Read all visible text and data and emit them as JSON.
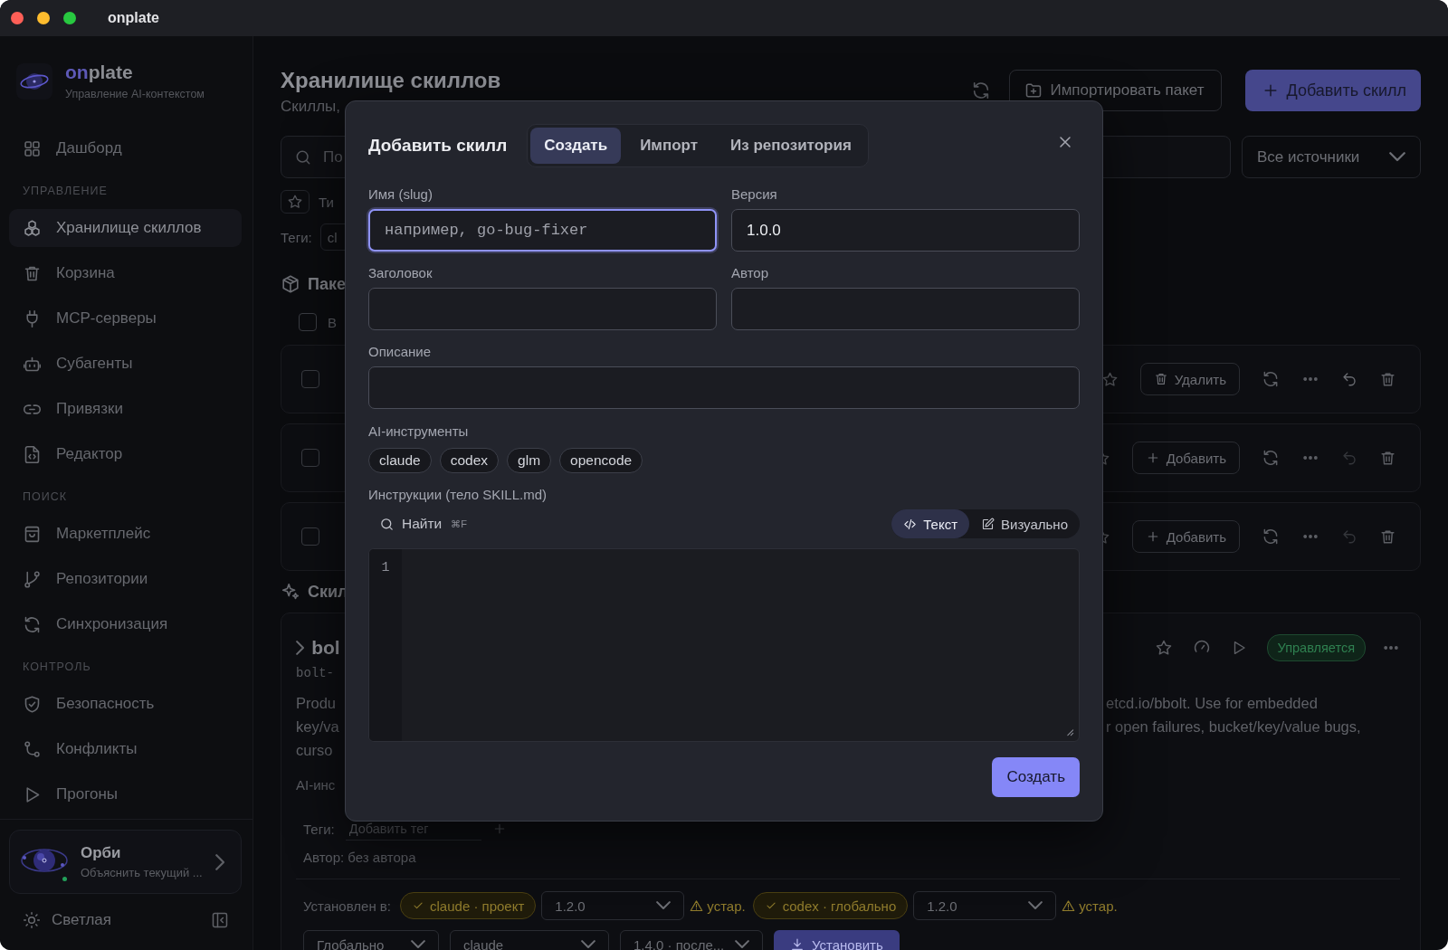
{
  "window": {
    "title": "onplate"
  },
  "sidebar": {
    "brand": {
      "accent": "on",
      "rest": "plate",
      "tagline": "Управление AI-контекстом"
    },
    "sections": [
      {
        "items": [
          {
            "label": "Дашборд",
            "selected": false
          }
        ]
      },
      {
        "heading": "УПРАВЛЕНИЕ",
        "items": [
          {
            "label": "Хранилище скиллов",
            "selected": true
          },
          {
            "label": "Корзина",
            "selected": false
          },
          {
            "label": "MCP-серверы",
            "selected": false
          },
          {
            "label": "Субагенты",
            "selected": false
          },
          {
            "label": "Привязки",
            "selected": false
          },
          {
            "label": "Редактор",
            "selected": false
          }
        ]
      },
      {
        "heading": "ПОИСК",
        "items": [
          {
            "label": "Маркетплейс",
            "selected": false
          },
          {
            "label": "Репозитории",
            "selected": false
          },
          {
            "label": "Синхронизация",
            "selected": false
          }
        ]
      },
      {
        "heading": "КОНТРОЛЬ",
        "items": [
          {
            "label": "Безопасность",
            "selected": false
          },
          {
            "label": "Конфликты",
            "selected": false
          },
          {
            "label": "Прогоны",
            "selected": false
          }
        ]
      }
    ],
    "assistant": {
      "name": "Орби",
      "hint": "Объяснить текущий ...",
      "online": true
    },
    "theme_toggle": "Светлая"
  },
  "page": {
    "title": "Хранилище скиллов",
    "subtitle": "Скиллы,",
    "import_button": "Импортировать пакет",
    "add_button": "Добавить скилл",
    "search_placeholder": "По",
    "source_filter": "Все источники",
    "type_label": "Ти",
    "tags_label": "Теги:",
    "tags": [
      "cl"
    ]
  },
  "packages": {
    "heading": "Паке",
    "select_all": {
      "label": "В",
      "checked": false
    },
    "rows": [
      {
        "checked": false,
        "kind": "remove",
        "action": "Удалить",
        "undo_enabled": true
      },
      {
        "checked": false,
        "kind": "add",
        "action": "Добавить",
        "undo_enabled": false
      },
      {
        "checked": false,
        "kind": "add",
        "action": "Добавить",
        "undo_enabled": false
      }
    ]
  },
  "skills": {
    "heading": "Скил",
    "card": {
      "expanded": false,
      "name": "bol",
      "slug": "bolt-",
      "description_start": [
        "Produ",
        "key/va",
        "curso"
      ],
      "description_end": [
        "etcd.io/bbolt. Use for embedded",
        "r open failures, bucket/key/value bugs,"
      ],
      "status": "Управляется",
      "tools_label": "AI-инс",
      "tags_label": "Теги:",
      "tag_placeholder": "Добавить тег",
      "author": "Автор: без автора",
      "installed_label": "Установлен в:",
      "installs": [
        {
          "target": "claude · проект",
          "version": "1.2.0",
          "warning": "устар."
        },
        {
          "target": "codex · глобально",
          "version": "1.2.0",
          "warning": "устар."
        }
      ],
      "install": {
        "scope": "Глобально",
        "tool": "claude",
        "version": "1.4.0 · после...",
        "button": "Установить"
      }
    }
  },
  "dialog": {
    "title": "Добавить скилл",
    "tabs": [
      {
        "label": "Создать",
        "selected": true
      },
      {
        "label": "Импорт",
        "selected": false
      },
      {
        "label": "Из репозитория",
        "selected": false
      }
    ],
    "fields": [
      {
        "label": "Имя (slug)",
        "placeholder": "например, go-bug-fixer",
        "focused": true
      },
      {
        "label": "Версия",
        "value": "1.0.0",
        "focused": false
      },
      {
        "label": "Заголовок",
        "focused": false
      },
      {
        "label": "Автор",
        "focused": false
      },
      {
        "label": "Описание",
        "focused": false
      }
    ],
    "tools_label": "AI-инструменты",
    "tools": [
      "claude",
      "codex",
      "glm",
      "opencode"
    ],
    "instructions_label": "Инструкции (тело SKILL.md)",
    "find": "Найти",
    "find_shortcut": "⌘F",
    "modes": [
      {
        "label": "Текст",
        "selected": true
      },
      {
        "label": "Визуально",
        "selected": false
      }
    ],
    "line_numbers": [
      "1"
    ],
    "submit": "Создать"
  }
}
